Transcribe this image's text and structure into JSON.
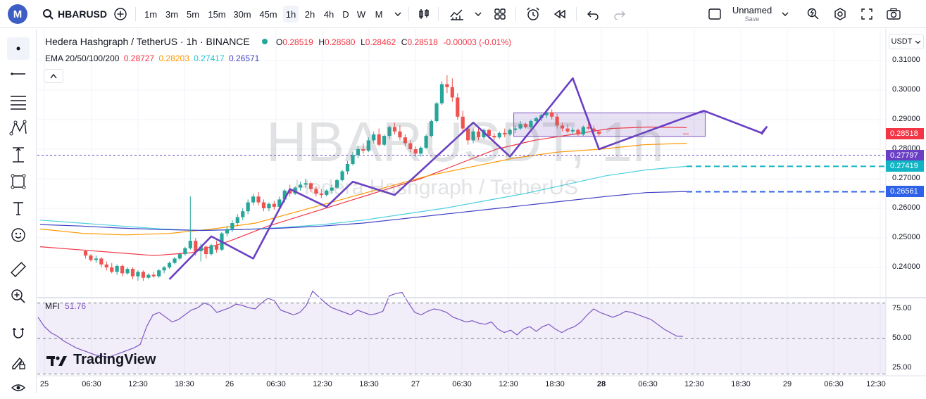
{
  "topbar": {
    "logo": "M",
    "symbol": "HBARUSD",
    "intervals": [
      "1m",
      "3m",
      "5m",
      "15m",
      "30m",
      "45m",
      "1h",
      "2h",
      "4h",
      "D",
      "W",
      "M"
    ],
    "active_interval": "1h",
    "layout_name": "Unnamed",
    "layout_sub": "Save"
  },
  "legend": {
    "title": "Hedera Hashgraph / TetherUS · 1h · BINANCE",
    "o_label": "O",
    "o": "0.28519",
    "h_label": "H",
    "h": "0.28580",
    "l_label": "L",
    "l": "0.28462",
    "c_label": "C",
    "c": "0.28518",
    "change": "-0.00003 (-0.01%)",
    "ema_label": "EMA 20/50/100/200",
    "ema20": "0.28727",
    "ema50": "0.28203",
    "ema100": "0.27417",
    "ema200": "0.26571"
  },
  "mfi": {
    "label": "MFI",
    "value": "51.76"
  },
  "watermark": {
    "symbol": "HBARUSDT, 1h",
    "name": "Hedera Hashgraph / TetherUS"
  },
  "brand": "TradingView",
  "currency": "USDT",
  "price_axis": {
    "ticks": [
      "0.31000",
      "0.30000",
      "0.29000",
      "0.28000",
      "0.27000",
      "0.26000",
      "0.25000",
      "0.24000"
    ],
    "boxes": [
      {
        "value": "0.28518",
        "color": "#f23645"
      },
      {
        "value": "0.27797",
        "color": "#6a3fc4"
      },
      {
        "value": "0.27419",
        "color": "#11b4c4"
      },
      {
        "value": "0.26561",
        "color": "#2d62e8"
      }
    ],
    "mfi_ticks": [
      "75.00",
      "50.00",
      "25.00"
    ]
  },
  "time_axis": [
    "25",
    "06:30",
    "12:30",
    "18:30",
    "26",
    "06:30",
    "12:30",
    "18:30",
    "27",
    "06:30",
    "12:30",
    "18:30",
    "28",
    "06:30",
    "12:30",
    "18:30",
    "29",
    "06:30",
    "12:30"
  ],
  "colors": {
    "up": "#26a69a",
    "down": "#ef5350",
    "ema20": "#f23645",
    "ema50": "#ff9800",
    "ema100": "#4dd0e1",
    "ema200": "#3f3fc4",
    "zigzag": "#6a3fc4"
  },
  "chart_data": {
    "type": "candlestick",
    "timeframe": "1h",
    "ylim": [
      0.2335,
      0.3145
    ],
    "close_last": 0.28518,
    "candles": [
      [
        0.2455,
        0.246,
        0.243,
        0.244
      ],
      [
        0.244,
        0.2445,
        0.242,
        0.2425
      ],
      [
        0.2425,
        0.244,
        0.2415,
        0.243
      ],
      [
        0.243,
        0.2435,
        0.24,
        0.241
      ],
      [
        0.241,
        0.242,
        0.239,
        0.24
      ],
      [
        0.24,
        0.2415,
        0.238,
        0.2385
      ],
      [
        0.2385,
        0.241,
        0.2375,
        0.2405
      ],
      [
        0.2405,
        0.241,
        0.237,
        0.238
      ],
      [
        0.238,
        0.24,
        0.2375,
        0.2395
      ],
      [
        0.2395,
        0.24,
        0.236,
        0.237
      ],
      [
        0.237,
        0.239,
        0.2355,
        0.2385
      ],
      [
        0.2385,
        0.239,
        0.2355,
        0.2365
      ],
      [
        0.2365,
        0.238,
        0.236,
        0.2375
      ],
      [
        0.2375,
        0.2385,
        0.2365,
        0.237
      ],
      [
        0.237,
        0.2395,
        0.2365,
        0.239
      ],
      [
        0.239,
        0.2405,
        0.238,
        0.24
      ],
      [
        0.24,
        0.242,
        0.2395,
        0.2415
      ],
      [
        0.2415,
        0.2435,
        0.241,
        0.243
      ],
      [
        0.243,
        0.245,
        0.2425,
        0.2445
      ],
      [
        0.2445,
        0.247,
        0.244,
        0.2465
      ],
      [
        0.2465,
        0.264,
        0.246,
        0.249
      ],
      [
        0.249,
        0.25,
        0.244,
        0.2455
      ],
      [
        0.2455,
        0.248,
        0.242,
        0.247
      ],
      [
        0.247,
        0.2475,
        0.243,
        0.2445
      ],
      [
        0.2445,
        0.248,
        0.244,
        0.2475
      ],
      [
        0.2475,
        0.249,
        0.245,
        0.246
      ],
      [
        0.246,
        0.252,
        0.2455,
        0.2515
      ],
      [
        0.2515,
        0.254,
        0.2505,
        0.253
      ],
      [
        0.253,
        0.256,
        0.252,
        0.255
      ],
      [
        0.255,
        0.258,
        0.254,
        0.257
      ],
      [
        0.257,
        0.26,
        0.256,
        0.259
      ],
      [
        0.259,
        0.263,
        0.258,
        0.262
      ],
      [
        0.262,
        0.265,
        0.261,
        0.264
      ],
      [
        0.264,
        0.2655,
        0.261,
        0.262
      ],
      [
        0.262,
        0.263,
        0.259,
        0.26
      ],
      [
        0.26,
        0.262,
        0.259,
        0.2615
      ],
      [
        0.2615,
        0.2625,
        0.2595,
        0.2605
      ],
      [
        0.2605,
        0.264,
        0.26,
        0.263
      ],
      [
        0.263,
        0.2665,
        0.262,
        0.266
      ],
      [
        0.266,
        0.268,
        0.264,
        0.265
      ],
      [
        0.265,
        0.2675,
        0.2645,
        0.267
      ],
      [
        0.267,
        0.269,
        0.266,
        0.268
      ],
      [
        0.268,
        0.27,
        0.267,
        0.2685
      ],
      [
        0.2685,
        0.269,
        0.2655,
        0.2665
      ],
      [
        0.2665,
        0.2675,
        0.264,
        0.265
      ],
      [
        0.265,
        0.2665,
        0.2635,
        0.2645
      ],
      [
        0.2645,
        0.2665,
        0.264,
        0.266
      ],
      [
        0.266,
        0.268,
        0.265,
        0.267
      ],
      [
        0.267,
        0.27,
        0.2665,
        0.2695
      ],
      [
        0.2695,
        0.273,
        0.269,
        0.2725
      ],
      [
        0.2725,
        0.276,
        0.2715,
        0.275
      ],
      [
        0.275,
        0.279,
        0.2745,
        0.278
      ],
      [
        0.278,
        0.281,
        0.277,
        0.28
      ],
      [
        0.28,
        0.282,
        0.2785,
        0.2795
      ],
      [
        0.2795,
        0.284,
        0.279,
        0.283
      ],
      [
        0.283,
        0.286,
        0.282,
        0.285
      ],
      [
        0.285,
        0.287,
        0.281,
        0.2815
      ],
      [
        0.2815,
        0.285,
        0.281,
        0.2845
      ],
      [
        0.2845,
        0.288,
        0.2835,
        0.2875
      ],
      [
        0.2875,
        0.289,
        0.285,
        0.286
      ],
      [
        0.286,
        0.288,
        0.283,
        0.284
      ],
      [
        0.284,
        0.285,
        0.281,
        0.282
      ],
      [
        0.282,
        0.283,
        0.279,
        0.28
      ],
      [
        0.28,
        0.281,
        0.2775,
        0.2785
      ],
      [
        0.2785,
        0.281,
        0.2775,
        0.2805
      ],
      [
        0.2805,
        0.285,
        0.28,
        0.2845
      ],
      [
        0.2845,
        0.29,
        0.284,
        0.2895
      ],
      [
        0.2895,
        0.296,
        0.289,
        0.2955
      ],
      [
        0.2955,
        0.303,
        0.295,
        0.302
      ],
      [
        0.302,
        0.305,
        0.299,
        0.301
      ],
      [
        0.301,
        0.304,
        0.296,
        0.2975
      ],
      [
        0.2975,
        0.299,
        0.29,
        0.291
      ],
      [
        0.291,
        0.293,
        0.286,
        0.287
      ],
      [
        0.287,
        0.288,
        0.2815,
        0.283
      ],
      [
        0.283,
        0.287,
        0.282,
        0.286
      ],
      [
        0.286,
        0.2875,
        0.283,
        0.284
      ],
      [
        0.284,
        0.287,
        0.2835,
        0.2865
      ],
      [
        0.2865,
        0.287,
        0.2835,
        0.2845
      ],
      [
        0.2845,
        0.2855,
        0.283,
        0.284
      ],
      [
        0.284,
        0.286,
        0.2835,
        0.2855
      ],
      [
        0.2855,
        0.287,
        0.284,
        0.285
      ],
      [
        0.285,
        0.287,
        0.2845,
        0.2865
      ],
      [
        0.2865,
        0.288,
        0.2855,
        0.287
      ],
      [
        0.287,
        0.2895,
        0.2865,
        0.2885
      ],
      [
        0.2885,
        0.289,
        0.287,
        0.2875
      ],
      [
        0.2875,
        0.29,
        0.287,
        0.2895
      ],
      [
        0.2895,
        0.291,
        0.2885,
        0.2905
      ],
      [
        0.2905,
        0.292,
        0.2895,
        0.2915
      ],
      [
        0.2915,
        0.2935,
        0.2905,
        0.2925
      ],
      [
        0.2925,
        0.2935,
        0.29,
        0.291
      ],
      [
        0.291,
        0.292,
        0.287,
        0.288
      ],
      [
        0.288,
        0.289,
        0.286,
        0.287
      ],
      [
        0.287,
        0.2885,
        0.2855,
        0.286
      ],
      [
        0.286,
        0.2875,
        0.285,
        0.2865
      ],
      [
        0.2865,
        0.287,
        0.2845,
        0.285
      ],
      [
        0.285,
        0.288,
        0.2845,
        0.2875
      ],
      [
        0.2875,
        0.2895,
        0.2865,
        0.287
      ],
      [
        0.287,
        0.288,
        0.285,
        0.286
      ],
      [
        0.286,
        0.286,
        0.2845,
        0.2852
      ]
    ],
    "ema20": [
      0.247,
      0.246,
      0.245,
      0.244,
      0.245,
      0.249,
      0.254,
      0.258,
      0.262,
      0.266,
      0.27,
      0.275,
      0.28,
      0.283,
      0.285,
      0.287,
      0.2875,
      0.2873
    ],
    "ema50": [
      0.253,
      0.2515,
      0.251,
      0.2515,
      0.253,
      0.255,
      0.259,
      0.263,
      0.267,
      0.271,
      0.274,
      0.277,
      0.279,
      0.28,
      0.2815,
      0.282
    ],
    "ema100": [
      0.256,
      0.255,
      0.254,
      0.253,
      0.2525,
      0.2528,
      0.2535,
      0.2545,
      0.256,
      0.258,
      0.26,
      0.2625,
      0.265,
      0.268,
      0.271,
      0.273,
      0.2742
    ],
    "ema200": [
      0.2545,
      0.254,
      0.2533,
      0.2528,
      0.2525,
      0.2528,
      0.2533,
      0.254,
      0.255,
      0.2565,
      0.258,
      0.2595,
      0.261,
      0.2625,
      0.264,
      0.2653,
      0.2657
    ],
    "zigzag": [
      [
        16,
        0.236
      ],
      [
        24,
        0.2505
      ],
      [
        32,
        0.243
      ],
      [
        39,
        0.2665
      ],
      [
        46,
        0.2605
      ],
      [
        51,
        0.269
      ],
      [
        59,
        0.2645
      ],
      [
        74,
        0.289
      ],
      [
        81,
        0.2775
      ],
      [
        93,
        0.304
      ],
      [
        98,
        0.28
      ],
      [
        118,
        0.293
      ],
      [
        129,
        0.2855
      ],
      [
        130,
        0.2875
      ],
      [
        129,
        0.285
      ]
    ],
    "rectangle": {
      "top": 0.2923,
      "bottom": 0.2843,
      "start_index": 90,
      "end_index": 126
    },
    "hlines": [
      0.27797,
      0.27419,
      0.26561
    ],
    "mfi": [
      68,
      60,
      55,
      52,
      48,
      45,
      42,
      40,
      38,
      36,
      35,
      34,
      36,
      38,
      40,
      42,
      45,
      60,
      70,
      72,
      68,
      64,
      66,
      70,
      74,
      76,
      80,
      78,
      72,
      74,
      76,
      79,
      78,
      76,
      75,
      80,
      84,
      82,
      74,
      72,
      70,
      72,
      78,
      90,
      85,
      80,
      76,
      74,
      72,
      70,
      74,
      72,
      70,
      71,
      73,
      86,
      88,
      89,
      80,
      72,
      70,
      73,
      75,
      74,
      72,
      68,
      66,
      64,
      65,
      63,
      62,
      64,
      58,
      55,
      57,
      53,
      58,
      60,
      56,
      60,
      62,
      58,
      55,
      58,
      60,
      64,
      70,
      75,
      72,
      70,
      68,
      70,
      73,
      72,
      70,
      68,
      66,
      62,
      58,
      55,
      52,
      51.76
    ]
  }
}
